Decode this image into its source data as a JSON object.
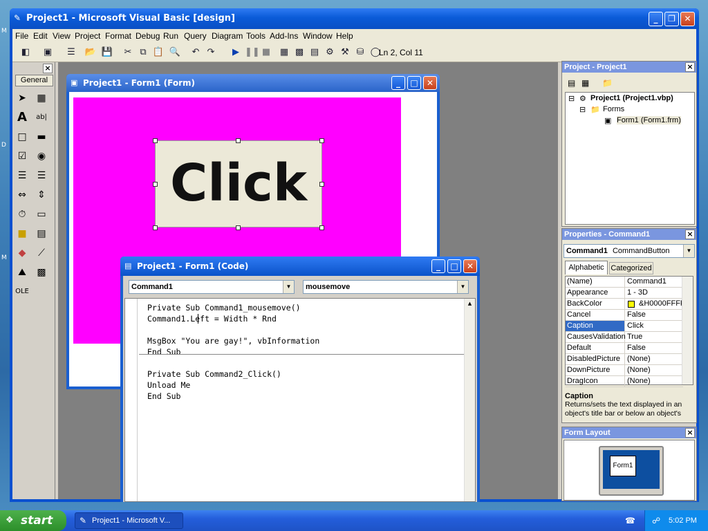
{
  "window": {
    "title": "Project1 - Microsoft Visual Basic [design]"
  },
  "menu": [
    "File",
    "Edit",
    "View",
    "Project",
    "Format",
    "Debug",
    "Run",
    "Query",
    "Diagram",
    "Tools",
    "Add-Ins",
    "Window",
    "Help"
  ],
  "toolbar": {
    "status": "Ln 2, Col 11"
  },
  "toolbox": {
    "tab": "General"
  },
  "form_window": {
    "title": "Project1 - Form1 (Form)",
    "button_caption": "Click"
  },
  "code_window": {
    "title": "Project1 - Form1 (Code)",
    "object_combo": "Command1",
    "proc_combo": "mousemove",
    "lines": [
      "Private Sub Command1_mousemove()",
      "Command1.Left = Width * Rnd",
      "",
      "MsgBox \"You are gay!\", vbInformation",
      "End Sub",
      "",
      "Private Sub Command2_Click()",
      "Unload Me",
      "End Sub"
    ]
  },
  "project_explorer": {
    "title": "Project - Project1",
    "root": "Project1 (Project1.vbp)",
    "folder": "Forms",
    "item": "Form1 (Form1.frm)"
  },
  "properties": {
    "title": "Properties - Command1",
    "object": "Command1",
    "object_type": "CommandButton",
    "tabs": [
      "Alphabetic",
      "Categorized"
    ],
    "rows": [
      {
        "name": "(Name)",
        "value": "Command1"
      },
      {
        "name": "Appearance",
        "value": "1 - 3D"
      },
      {
        "name": "BackColor",
        "value": "&H0000FFFF"
      },
      {
        "name": "Cancel",
        "value": "False"
      },
      {
        "name": "Caption",
        "value": "Click"
      },
      {
        "name": "CausesValidation",
        "value": "True"
      },
      {
        "name": "Default",
        "value": "False"
      },
      {
        "name": "DisabledPicture",
        "value": "(None)"
      },
      {
        "name": "DownPicture",
        "value": "(None)"
      },
      {
        "name": "DragIcon",
        "value": "(None)"
      }
    ],
    "desc_title": "Caption",
    "desc_text": "Returns/sets the text displayed in an object's title bar or below an object's"
  },
  "form_layout": {
    "title": "Form Layout",
    "form_label": "Form1"
  },
  "taskbar": {
    "start": "start",
    "task": "Project1 - Microsoft V...",
    "clock": "5:02 PM"
  },
  "colors": {
    "form_back": "#ff00ff",
    "selection": "#316ac5",
    "backcolor_swatch": "#ffff00"
  }
}
